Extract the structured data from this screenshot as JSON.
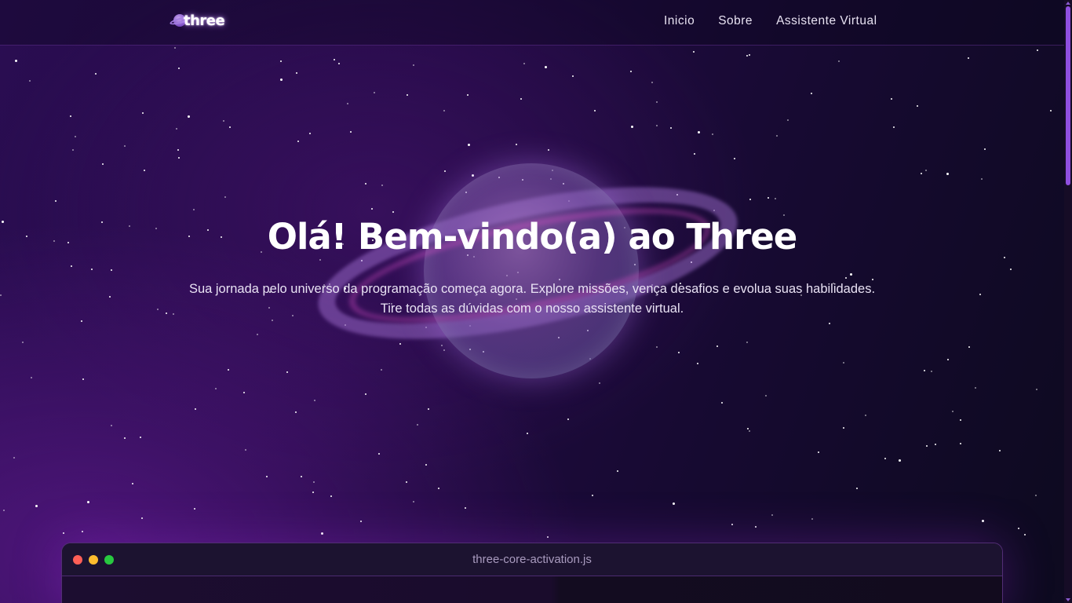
{
  "header": {
    "logo_text": "three",
    "logo_icon": "planet-icon",
    "nav": [
      {
        "label": "Inicio"
      },
      {
        "label": "Sobre"
      },
      {
        "label": "Assistente Virtual"
      }
    ]
  },
  "hero": {
    "title": "Olá! Bem-vindo(a) ao Three",
    "subtitle_line1": "Sua jornada pelo universo da programação começa agora. Explore missões, vença desafios e evolua suas habilidades.",
    "subtitle_line2": "Tire todas as dúvidas com o nosso assistente virtual."
  },
  "code_window": {
    "title": "three-core-activation.js"
  },
  "colors": {
    "accent": "#8f4fe0",
    "background": "#230a45",
    "window_dot_red": "#ff5f57",
    "window_dot_yellow": "#febc2e",
    "window_dot_green": "#28c840"
  }
}
